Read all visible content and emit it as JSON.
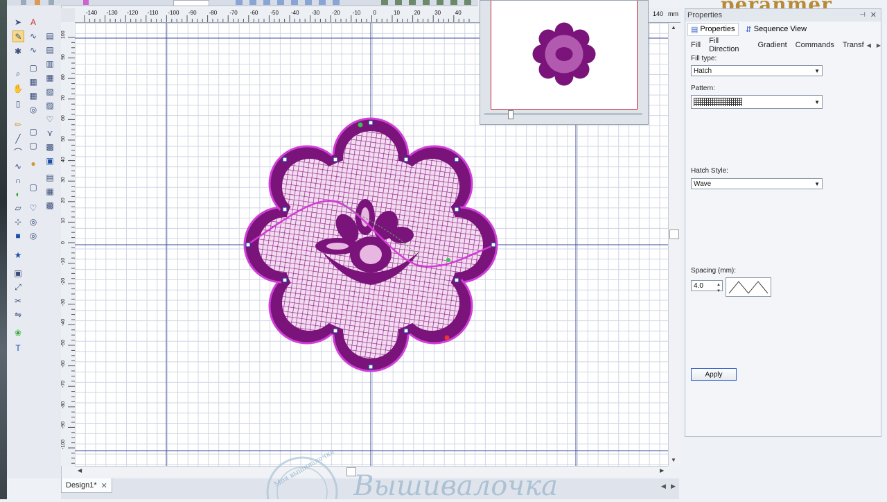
{
  "title_fragment": "peranmer",
  "ruler": {
    "unit": "mm",
    "h_ticks": [
      "-140",
      "-130",
      "-120",
      "-110",
      "-100",
      "-90",
      "-80",
      "-70",
      "-60",
      "-50",
      "-40",
      "-30",
      "-20",
      "-10",
      "0",
      "10",
      "20",
      "30",
      "40"
    ],
    "h_tail": "140",
    "v_ticks": [
      "100",
      "90",
      "80",
      "70",
      "60",
      "50",
      "40",
      "30",
      "20",
      "10",
      "0",
      "-10",
      "-20",
      "-30",
      "-40",
      "-50",
      "-60",
      "-70",
      "-80",
      "-90",
      "-100"
    ]
  },
  "document_tab": {
    "label": "Design1*"
  },
  "panel": {
    "title": "Properties",
    "tabs": [
      "Properties",
      "Sequence View"
    ],
    "fill_tabs": [
      "Fill",
      "Fill Direction",
      "Gradient",
      "Commands",
      "Transf"
    ],
    "fill_type": {
      "label": "Fill type:",
      "value": "Hatch"
    },
    "pattern": {
      "label": "Pattern:"
    },
    "hatch_style": {
      "label": "Hatch Style:",
      "value": "Wave"
    },
    "spacing": {
      "label": "Spacing (mm):",
      "value": "4.0"
    },
    "apply_label": "Apply"
  },
  "watermark": {
    "arc_text": "Моя вышивалочка",
    "script_text": "Вышивалочка"
  },
  "colors": {
    "design_main": "#8a1a86",
    "design_light": "#e7b7e2",
    "design_outline": "#c43ad3",
    "selection": "#d43ad6",
    "apply_border": "#3a66c8"
  },
  "icons": {
    "close": "close-icon",
    "pin": "pin-icon",
    "properties": "properties-icon",
    "sequence": "sequence-icon"
  }
}
